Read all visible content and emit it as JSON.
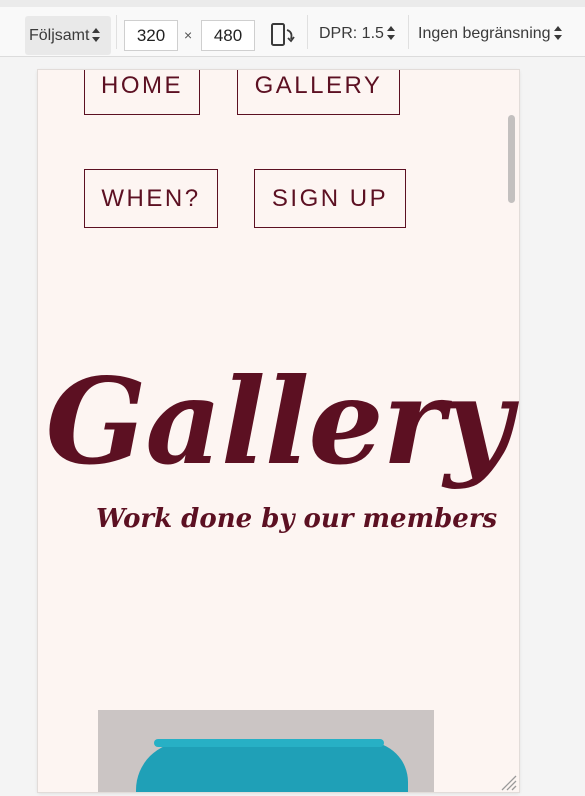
{
  "toolbar": {
    "mode_label": "Följsamt",
    "width_value": "320",
    "times_symbol": "×",
    "height_value": "480",
    "dpr_label": "DPR: 1.5",
    "throttle_label": "Ingen begränsning"
  },
  "page": {
    "nav": {
      "home": "HOME",
      "gallery": "GALLERY",
      "when": "WHEN?",
      "signup": "SIGN UP"
    },
    "hero_title": "Gallery",
    "hero_subtitle": "Work done by our members"
  },
  "colors": {
    "brand": "#5c1022",
    "page_background": "#fdf5f2",
    "paint": "#1fa0b7"
  }
}
